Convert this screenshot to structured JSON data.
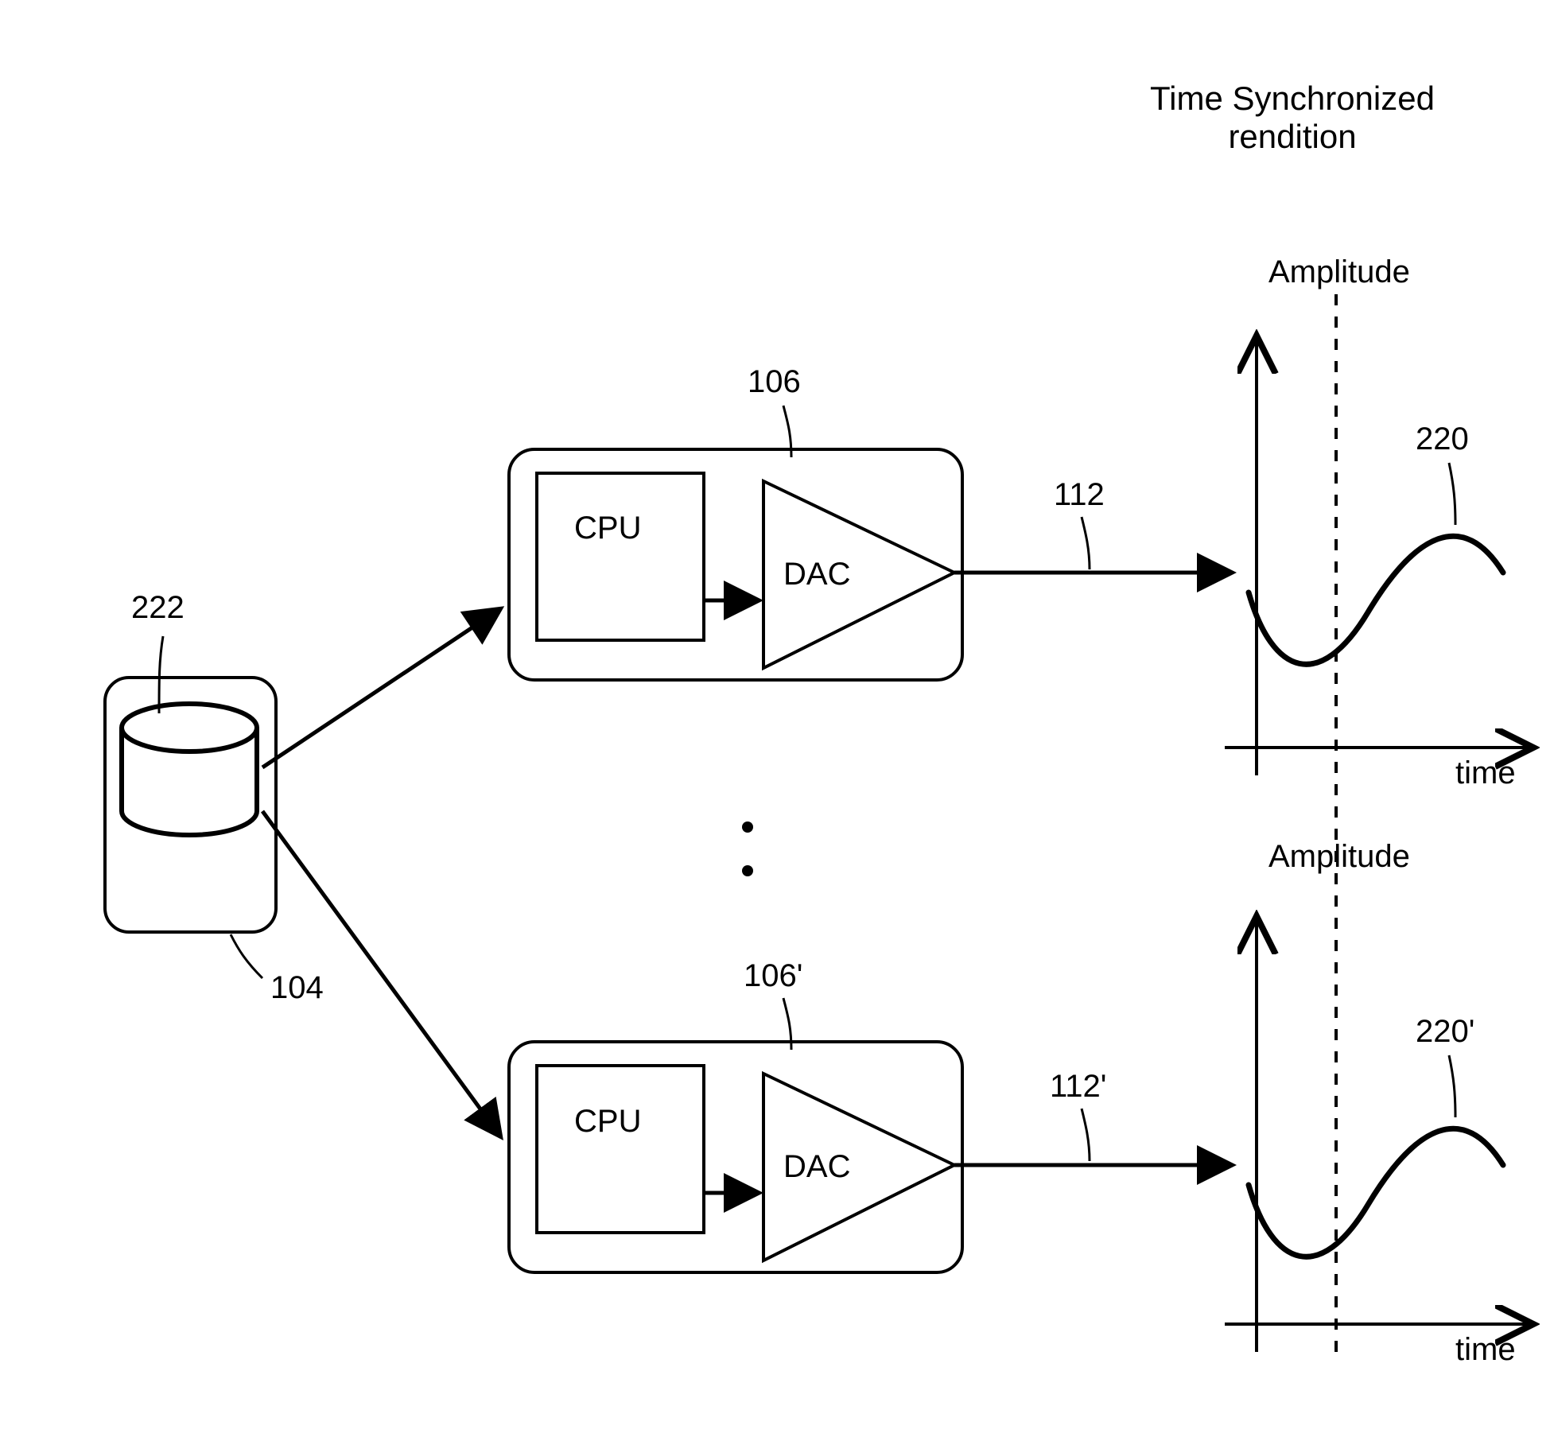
{
  "title": {
    "line1": "Time Synchronized",
    "line2": "rendition"
  },
  "source": {
    "ref": "222",
    "containerRef": "104"
  },
  "nodes": [
    {
      "cpu": "CPU",
      "dac": "DAC",
      "ref": "106",
      "outRef": "112"
    },
    {
      "cpu": "CPU",
      "dac": "DAC",
      "ref": "106'",
      "outRef": "112'"
    }
  ],
  "graphs": [
    {
      "amplitude": "Amplitude",
      "time": "time",
      "ref": "220"
    },
    {
      "amplitude": "Amplitude",
      "time": "time",
      "ref": "220'"
    }
  ]
}
